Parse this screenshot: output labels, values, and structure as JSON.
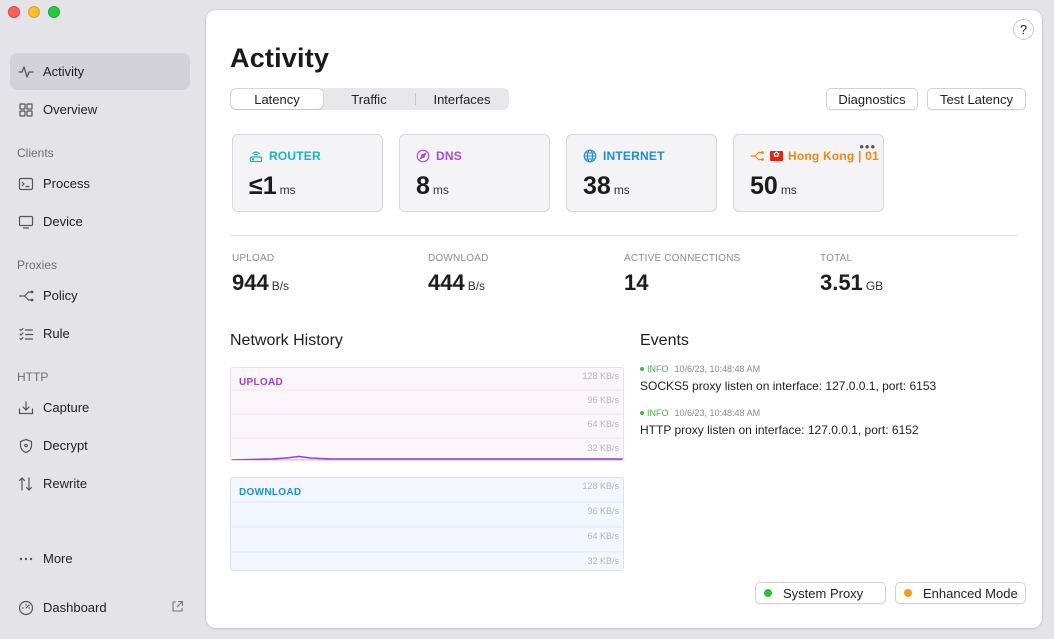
{
  "sidebar": {
    "items": {
      "activity": "Activity",
      "overview": "Overview",
      "process": "Process",
      "device": "Device",
      "policy": "Policy",
      "rule": "Rule",
      "capture": "Capture",
      "decrypt": "Decrypt",
      "rewrite": "Rewrite",
      "more": "More",
      "dashboard": "Dashboard"
    },
    "sections": {
      "clients": "Clients",
      "proxies": "Proxies",
      "http": "HTTP"
    },
    "active": "activity"
  },
  "main": {
    "title": "Activity",
    "help": "?",
    "tabs": [
      "Latency",
      "Traffic",
      "Interfaces"
    ],
    "selected_tab": "Latency",
    "buttons": {
      "diagnostics": "Diagnostics",
      "test_latency": "Test Latency"
    }
  },
  "latency": {
    "router": {
      "label": "ROUTER",
      "value": "≤1",
      "unit": "ms",
      "color": "#1fb0c7"
    },
    "dns": {
      "label": "DNS",
      "value": "8",
      "unit": "ms",
      "color": "#a64fd6"
    },
    "internet": {
      "label": "INTERNET",
      "value": "38",
      "unit": "ms",
      "color": "#1a8fd8"
    },
    "proxy": {
      "label": "Hong Kong | 01",
      "value": "50",
      "unit": "ms",
      "color": "#f0870f",
      "more": "•••"
    }
  },
  "stats": {
    "upload": {
      "label": "UPLOAD",
      "value": "944",
      "unit": "B/s"
    },
    "download": {
      "label": "DOWNLOAD",
      "value": "444",
      "unit": "B/s"
    },
    "active": {
      "label": "ACTIVE CONNECTIONS",
      "value": "14"
    },
    "total": {
      "label": "TOTAL",
      "value": "3.51",
      "unit": "GB"
    }
  },
  "network_history": {
    "title": "Network History",
    "upload": {
      "label": "UPLOAD",
      "color": "#9a3fce",
      "ticks": [
        "128 KB/s",
        "96 KB/s",
        "64 KB/s",
        "32 KB/s"
      ]
    },
    "download": {
      "label": "DOWNLOAD",
      "color": "#1c8fdd",
      "ticks": [
        "128 KB/s",
        "96 KB/s",
        "64 KB/s",
        "32 KB/s"
      ]
    }
  },
  "events": {
    "title": "Events",
    "items": [
      {
        "level": "INFO",
        "time": "10/6/23, 10:48:48 AM",
        "message": "SOCKS5 proxy listen on interface: 127.0.0.1, port: 6153"
      },
      {
        "level": "INFO",
        "time": "10/6/23, 10:48:48 AM",
        "message": "HTTP proxy listen on interface: 127.0.0.1, port: 6152"
      }
    ]
  },
  "footer": {
    "system_proxy": {
      "label": "System Proxy",
      "color": "#2fbe3b"
    },
    "enhanced_mode": {
      "label": "Enhanced Mode",
      "color": "#f39b1a"
    }
  }
}
